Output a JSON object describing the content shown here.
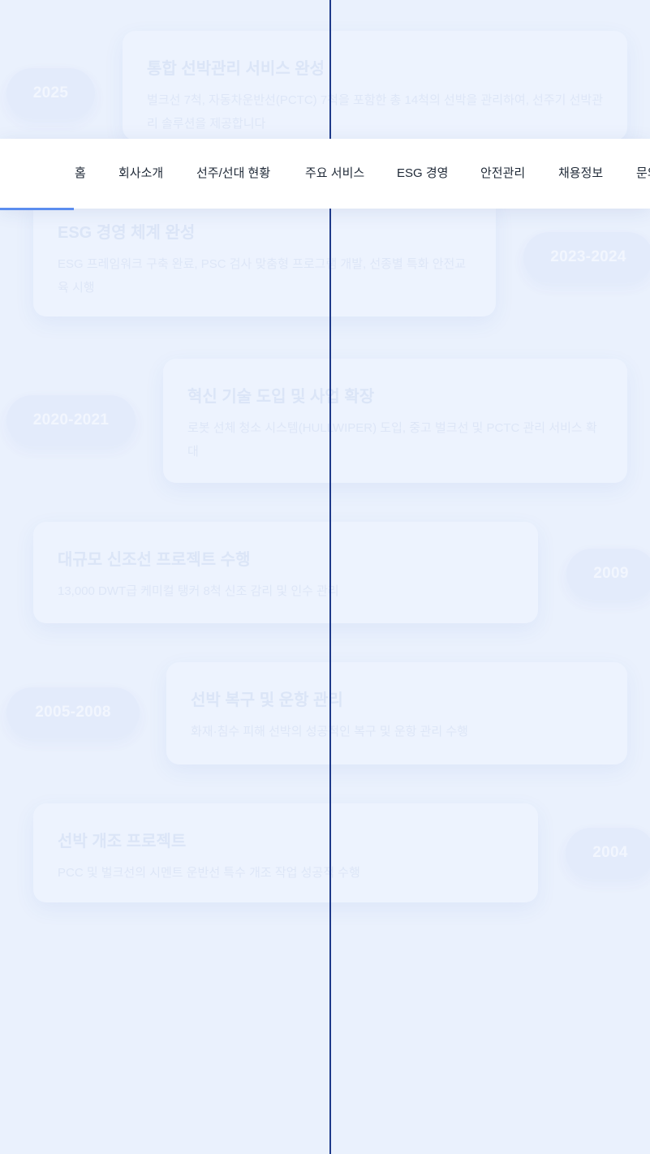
{
  "nav": {
    "items": [
      {
        "label": "홈"
      },
      {
        "label": "회사소개"
      },
      {
        "label": "선주/선대 현황"
      },
      {
        "label": "주요 서비스"
      },
      {
        "label": "ESG 경영"
      },
      {
        "label": "안전관리"
      },
      {
        "label": "채용정보"
      },
      {
        "label": "문의"
      }
    ],
    "active_index": 0
  },
  "timeline": [
    {
      "year": "2025",
      "title": "통합 선박관리 서비스 완성",
      "desc": "벌크선 7척, 자동차운반선(PCTC) 7척을 포함한 총 14척의 선박을 관리하여, 선주기 선박관리 솔루션을 제공합니다"
    },
    {
      "year": "2023-2024",
      "title": "ESG 경영 체계 완성",
      "desc": "ESG 프레임워크 구축 완료, PSC 검사 맞춤형 프로그램 개발, 선종별 특화 안전교육 시행"
    },
    {
      "year": "2020-2021",
      "title": "혁신 기술 도입 및 사업 확장",
      "desc": "로봇 선체 청소 시스템(HULLWIPER) 도입, 중고 벌크선 및 PCTC 관리 서비스 확대"
    },
    {
      "year": "2009",
      "title": "대규모 신조선 프로젝트 수행",
      "desc": "13,000 DWT급 케미컬 탱커 8척 신조 감리 및 인수 관리"
    },
    {
      "year": "2005-2008",
      "title": "선박 복구 및 운항 관리",
      "desc": "화재·침수 피해 선박의 성공적인 복구 및 운항 관리 수행"
    },
    {
      "year": "2004",
      "title": "선박 개조 프로젝트",
      "desc": "PCC 및 벌크선의 시멘트 운반선 특수 개조 작업 성공적 수행"
    }
  ]
}
